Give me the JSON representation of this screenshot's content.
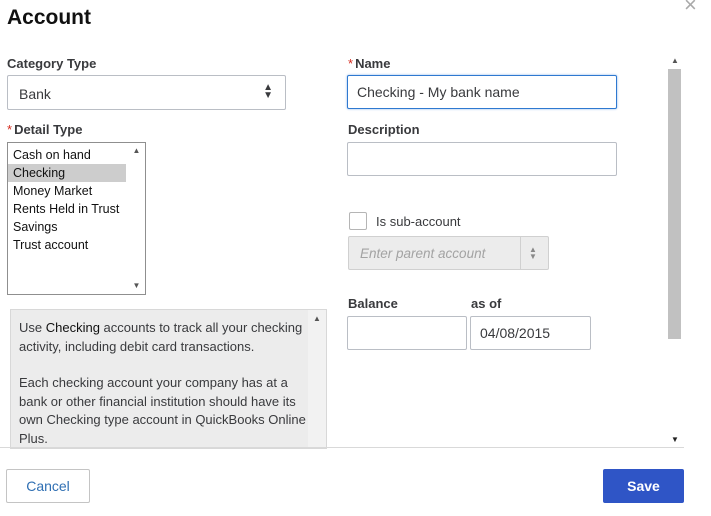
{
  "dialog": {
    "title": "Account"
  },
  "category_type": {
    "label": "Category Type",
    "value": "Bank"
  },
  "detail_type": {
    "label": "Detail Type",
    "required_mark": "*",
    "items": [
      "Cash on hand",
      "Checking",
      "Money Market",
      "Rents Held in Trust",
      "Savings",
      "Trust account"
    ],
    "selected": "Checking"
  },
  "detail_description": {
    "p1_prefix": "Use ",
    "p1_bold": "Checking",
    "p1_suffix": " accounts to track all your checking activity, including debit card transactions.",
    "p2": "Each checking account your company has at a bank or other financial institution should have its own Checking type account in QuickBooks Online Plus."
  },
  "name": {
    "label": "Name",
    "required_mark": "*",
    "value": "Checking - My bank name"
  },
  "description": {
    "label": "Description",
    "value": ""
  },
  "sub_account": {
    "label": "Is sub-account",
    "checked": false
  },
  "parent_account": {
    "placeholder": "Enter parent account"
  },
  "balance": {
    "label": "Balance",
    "value": ""
  },
  "as_of": {
    "label": "as of",
    "value": "04/08/2015"
  },
  "buttons": {
    "cancel": "Cancel",
    "save": "Save"
  },
  "colors": {
    "accent": "#2f55c6",
    "required": "#d52b1e",
    "link": "#2f6fb3"
  }
}
